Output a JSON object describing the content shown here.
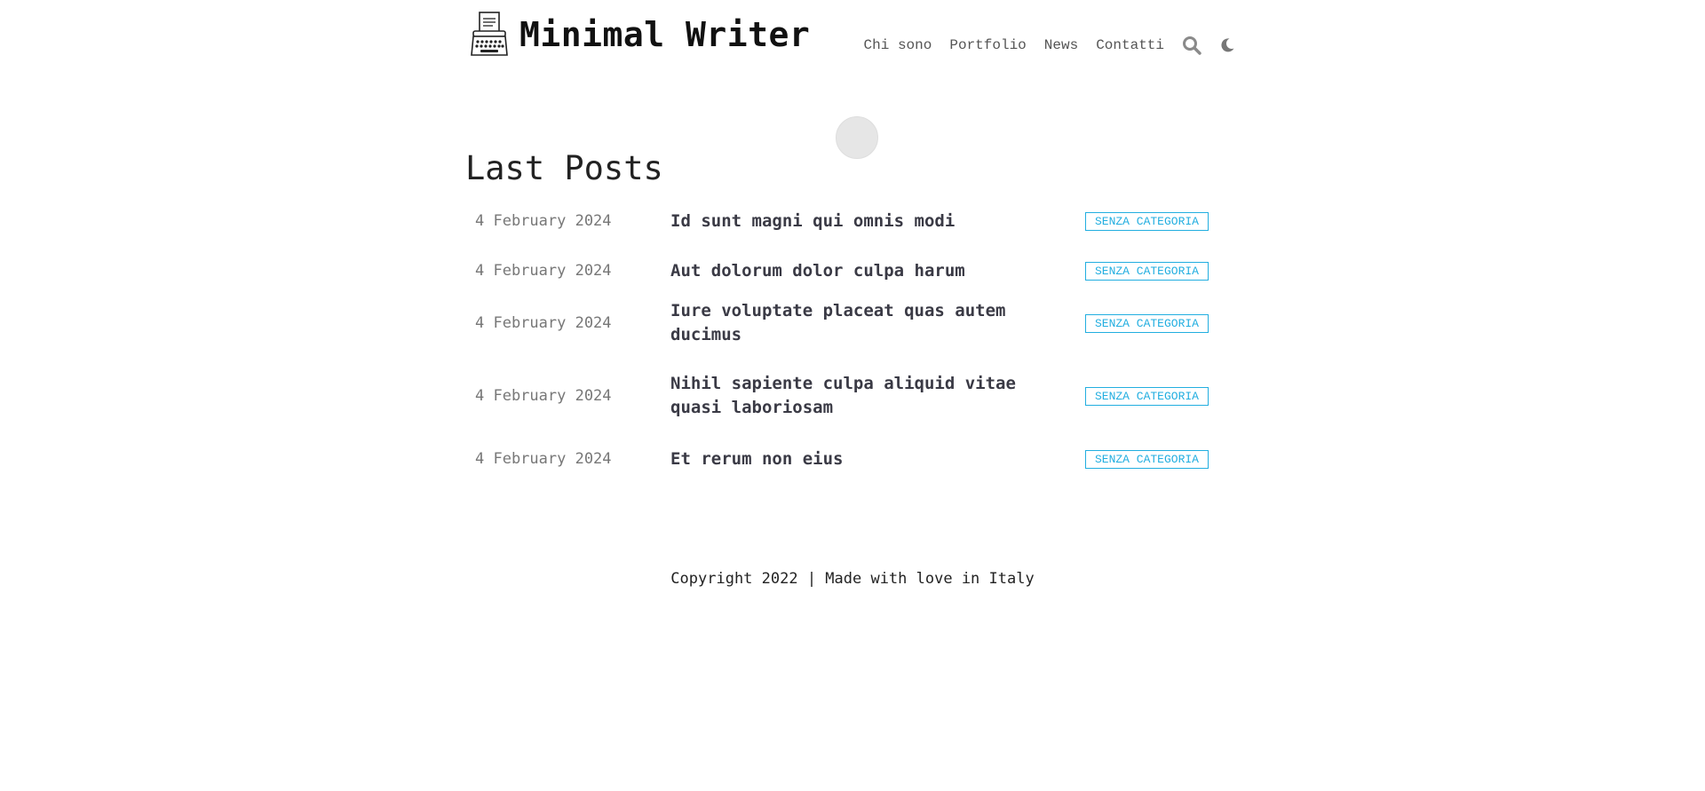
{
  "header": {
    "site_title": "Minimal Writer",
    "logo_icon": "typewriter-icon",
    "nav": [
      {
        "label": "Chi sono"
      },
      {
        "label": "Portfolio"
      },
      {
        "label": "News"
      },
      {
        "label": "Contatti"
      }
    ],
    "search_icon": "search-icon",
    "theme_icon": "moon-icon"
  },
  "main": {
    "section_title": "Last Posts",
    "posts": [
      {
        "date": "4 February 2024",
        "title": "Id sunt magni qui omnis modi",
        "category": "SENZA CATEGORIA"
      },
      {
        "date": "4 February 2024",
        "title": "Aut dolorum dolor culpa harum",
        "category": "SENZA CATEGORIA"
      },
      {
        "date": "4 February 2024",
        "title": "Iure voluptate placeat quas autem ducimus",
        "category": "SENZA CATEGORIA"
      },
      {
        "date": "4 February 2024",
        "title": "Nihil sapiente culpa aliquid vitae quasi laboriosam",
        "category": "SENZA CATEGORIA"
      },
      {
        "date": "4 February 2024",
        "title": "Et rerum non eius",
        "category": "SENZA CATEGORIA"
      }
    ]
  },
  "footer": {
    "text": "Copyright 2022 | Made with love in Italy"
  },
  "colors": {
    "accent": "#22aee0",
    "text": "#222222",
    "muted": "#777777"
  }
}
